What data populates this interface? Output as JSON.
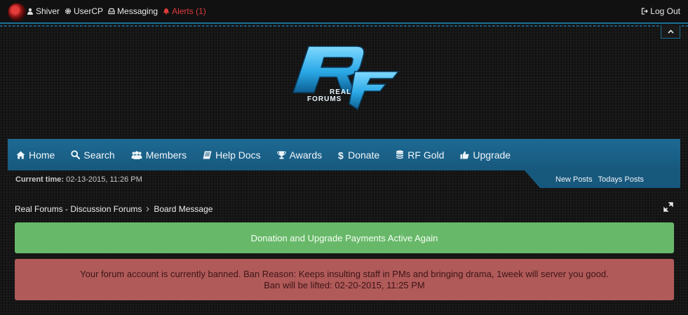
{
  "topbar": {
    "username": "Shiver",
    "usercp": "UserCP",
    "messaging": "Messaging",
    "alerts": "Alerts (1)",
    "logout": "Log Out"
  },
  "logo": {
    "line1": "REAL",
    "line2": "FORUMS"
  },
  "nav": {
    "items": [
      {
        "label": "Home",
        "icon": "home-icon"
      },
      {
        "label": "Search",
        "icon": "search-icon"
      },
      {
        "label": "Members",
        "icon": "users-icon"
      },
      {
        "label": "Help Docs",
        "icon": "book-icon"
      },
      {
        "label": "Awards",
        "icon": "trophy-icon"
      },
      {
        "label": "Donate",
        "icon": "dollar-icon"
      },
      {
        "label": "RF Gold",
        "icon": "coins-icon"
      },
      {
        "label": "Upgrade",
        "icon": "thumbs-up-icon"
      }
    ]
  },
  "subbar": {
    "time_label": "Current time:",
    "time_value": "02-13-2015, 11:26 PM",
    "new_posts": "New Posts",
    "todays_posts": "Todays Posts"
  },
  "breadcrumb": {
    "root": "Real Forums - Discussion Forums",
    "current": "Board Message"
  },
  "notices": {
    "green": "Donation and Upgrade Payments Active Again",
    "red_line1": "Your forum account is currently banned. Ban Reason: Keeps insulting staff in PMs and bringing drama, 1week will server you good.",
    "red_line2": "Ban will be lifted: 02-20-2015, 11:25 PM"
  },
  "colors": {
    "accent": "#1b6f96",
    "nav": "#17587d",
    "alert": "#e03b3b",
    "success": "#68b869",
    "danger": "#b15a5a"
  }
}
